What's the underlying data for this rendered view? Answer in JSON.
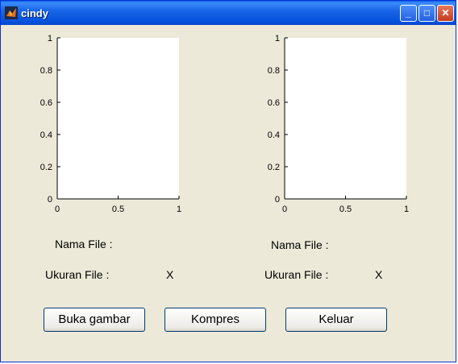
{
  "window": {
    "title": "cindy"
  },
  "title_buttons": {
    "minimize": "_",
    "maximize": "□",
    "close": "✕"
  },
  "axes": [
    {
      "x_ticks": [
        "0",
        "0.5",
        "1"
      ],
      "y_ticks": [
        "0",
        "0.2",
        "0.4",
        "0.6",
        "0.8",
        "1"
      ]
    },
    {
      "x_ticks": [
        "0",
        "0.5",
        "1"
      ],
      "y_ticks": [
        "0",
        "0.2",
        "0.4",
        "0.6",
        "0.8",
        "1"
      ]
    }
  ],
  "left_panel": {
    "file_name_label": "Nama File :",
    "file_size_label": "Ukuran File :",
    "file_size_value": "X"
  },
  "right_panel": {
    "file_name_label": "Nama File :",
    "file_size_label": "Ukuran File :",
    "file_size_value": "X"
  },
  "buttons": {
    "open": "Buka gambar",
    "compress": "Kompres",
    "exit": "Keluar"
  }
}
